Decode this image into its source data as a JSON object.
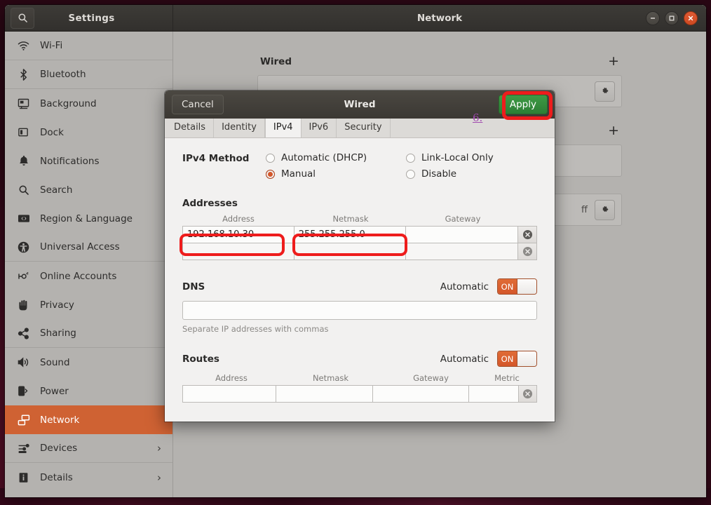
{
  "desktop": {
    "background_color": "#4a0d22"
  },
  "window": {
    "left_title": "Settings",
    "right_title": "Network",
    "search_icon": "search-icon",
    "controls": {
      "minimize": "minimize-icon",
      "maximize": "maximize-icon",
      "close": "close-icon"
    }
  },
  "sidebar": {
    "items": [
      {
        "label": "Wi-Fi",
        "icon": "wifi-icon",
        "selected": false,
        "chevron": ""
      },
      {
        "label": "Bluetooth",
        "icon": "bluetooth-icon",
        "selected": false,
        "chevron": ""
      },
      {
        "label": "Background",
        "icon": "background-icon",
        "selected": false,
        "chevron": ""
      },
      {
        "label": "Dock",
        "icon": "dock-icon",
        "selected": false,
        "chevron": ""
      },
      {
        "label": "Notifications",
        "icon": "bell-icon",
        "selected": false,
        "chevron": ""
      },
      {
        "label": "Search",
        "icon": "search-icon",
        "selected": false,
        "chevron": ""
      },
      {
        "label": "Region & Language",
        "icon": "language-icon",
        "selected": false,
        "chevron": ""
      },
      {
        "label": "Universal Access",
        "icon": "accessibility-icon",
        "selected": false,
        "chevron": ""
      },
      {
        "label": "Online Accounts",
        "icon": "online-accounts-icon",
        "selected": false,
        "chevron": ""
      },
      {
        "label": "Privacy",
        "icon": "privacy-hand-icon",
        "selected": false,
        "chevron": ""
      },
      {
        "label": "Sharing",
        "icon": "sharing-icon",
        "selected": false,
        "chevron": ""
      },
      {
        "label": "Sound",
        "icon": "sound-icon",
        "selected": false,
        "chevron": ""
      },
      {
        "label": "Power",
        "icon": "power-icon",
        "selected": false,
        "chevron": ""
      },
      {
        "label": "Network",
        "icon": "network-icon",
        "selected": true,
        "chevron": ""
      },
      {
        "label": "Devices",
        "icon": "devices-icon",
        "selected": false,
        "chevron": "›"
      },
      {
        "label": "Details",
        "icon": "details-icon",
        "selected": false,
        "chevron": "›"
      }
    ],
    "selected_color": "#cf6233"
  },
  "content": {
    "wired_heading": "Wired",
    "add_label": "+",
    "gear_icon": "gear-icon",
    "vpn_add_label": "+",
    "proxy_state": "ff"
  },
  "dialog": {
    "title": "Wired",
    "cancel_label": "Cancel",
    "apply_label": "Apply",
    "step_marker": "6.",
    "tabs": [
      {
        "label": "Details",
        "active": false
      },
      {
        "label": "Identity",
        "active": false
      },
      {
        "label": "IPv4",
        "active": true
      },
      {
        "label": "IPv6",
        "active": false
      },
      {
        "label": "Security",
        "active": false
      }
    ],
    "ipv4_method": {
      "label": "IPv4 Method",
      "options": [
        {
          "label": "Automatic (DHCP)",
          "selected": false
        },
        {
          "label": "Link-Local Only",
          "selected": false
        },
        {
          "label": "Manual",
          "selected": true
        },
        {
          "label": "Disable",
          "selected": false
        }
      ]
    },
    "addresses": {
      "label": "Addresses",
      "columns": [
        "Address",
        "Netmask",
        "Gateway"
      ],
      "rows": [
        {
          "address": "192.168.10.30",
          "netmask": "255.255.255.0",
          "gateway": ""
        },
        {
          "address": "",
          "netmask": "",
          "gateway": ""
        }
      ]
    },
    "dns": {
      "label": "DNS",
      "automatic_label": "Automatic",
      "toggle_state": "ON",
      "value": "",
      "hint": "Separate IP addresses with commas"
    },
    "routes": {
      "label": "Routes",
      "automatic_label": "Automatic",
      "toggle_state": "ON",
      "columns": [
        "Address",
        "Netmask",
        "Gateway",
        "Metric"
      ],
      "rows": [
        {
          "address": "",
          "netmask": "",
          "gateway": "",
          "metric": ""
        }
      ]
    }
  },
  "annotations": {
    "accent_red": "#ee1c1c",
    "step_color": "#a14ab0"
  }
}
